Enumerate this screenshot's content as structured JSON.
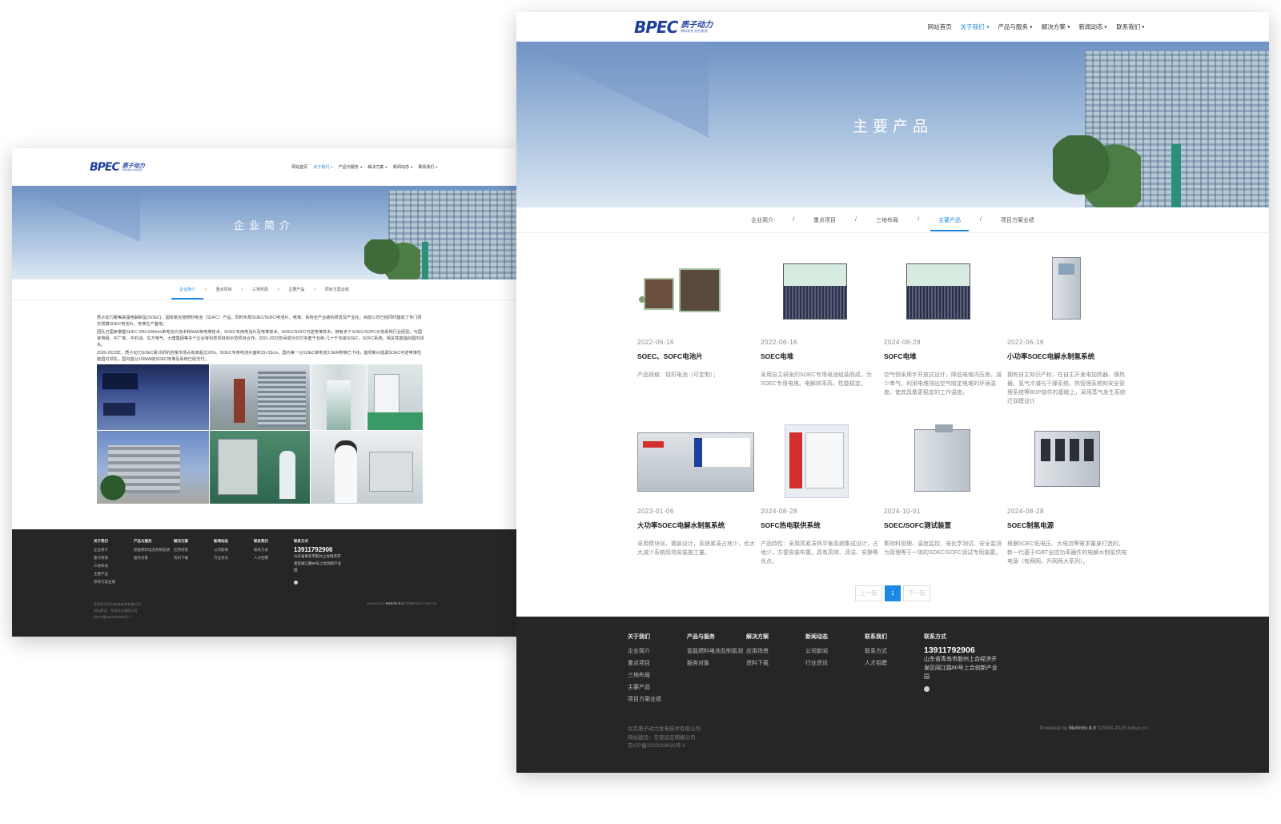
{
  "brand": {
    "logo_main": "BPEC",
    "logo_cn": "质子动力",
    "logo_sub": "燃料电池·综合能源"
  },
  "nav": [
    {
      "label": "网站首页",
      "dropdown": false,
      "active": false
    },
    {
      "label": "关于我们",
      "dropdown": true,
      "active": true
    },
    {
      "label": "产品与服务",
      "dropdown": true,
      "active": false
    },
    {
      "label": "解决方案",
      "dropdown": true,
      "active": false
    },
    {
      "label": "新闻动态",
      "dropdown": true,
      "active": false
    },
    {
      "label": "联系我们",
      "dropdown": true,
      "active": false
    }
  ],
  "tabs": [
    "企业简介",
    "重点项目",
    "三地布局",
    "主要产品",
    "项目方案业绩"
  ],
  "separator": "/",
  "left_page": {
    "banner_title": "企业简介",
    "active_tab": 0,
    "intro": [
      "质子动力聚焦高温电解制氢(SOEC)、固体氧化物燃料电池（SOFC）产品，同时布局SOEC/SOFC电池片、电堆、系统全产业链的研发及产业化。目前公司已经同时建成了专门研究规模SOEC电池片、电堆生产基地。",
      "团队已国家掌握SOFC 200×200mm单电池片技术和5kW单电堆技术，SOEC专用电池片及电堆技术。SOEC/SOFC可逆电堆技术。拥有多个SOEC/SOFC示范系统行业经验，与国家电网、中广核、中石油、东方电气、大唐集团等多个企业有科技项目和示范项目合作。2021-2023年间成功交付多套千瓦级-几十千瓦级SOEC、SOFC系统，相关性能指标国内领先。",
      "2020-2023年，质子动力SOEC累计研机容量市场占有率超过20%。SOEC专用电池片面积15×15cm，国内第一台SOEC单电池3.5kW电堆已下线，首项新兴能源SOEC可逆电堆性能国内领先，国内首台100kW级SOEC电堆及系统已经交付。"
    ]
  },
  "right_page": {
    "banner_title": "主要产品",
    "active_tab": 3,
    "products": [
      {
        "date": "2022-06-16",
        "name": "SOEC、SOFC电池片",
        "desc": "产品规格：钮扣电池（可定制）；",
        "kind": "plates"
      },
      {
        "date": "2022-06-16",
        "name": "SOEC电堆",
        "desc": "采用自主研发的SOEC专用电池组装而成，为SOEC专用电堆。电解效率高，性能稳定。",
        "kind": "stack"
      },
      {
        "date": "2024-08-28",
        "name": "SOFC电堆",
        "desc": "空气侧采用半开放式设计，降低电堆内压差，减少串气，利用电堆排出空气吸定电堆的环境温度，使其具备更稳定的工作温度。",
        "kind": "stack"
      },
      {
        "date": "2022-06-16",
        "name": "小功率SOEC电解水制氢系统",
        "desc": "拥有自主知识产权，在自主开发电加热器、换热器、氢气冷凝与干燥系统、热管理系统和安全管理系统等BOP部件的基础上，采用蒸气发生系统迁双模设计",
        "kind": "cabinet"
      },
      {
        "date": "2023-01-06",
        "name": "大功率SOEC电解水制氢系统",
        "desc": "采用模块化、撬装设计，系统紧凑占地少，也大大减少系统现场安装施工量。",
        "kind": "container"
      },
      {
        "date": "2024-08-28",
        "name": "SOFC热电联供系统",
        "desc": "产品特性：采用高紧凑热平衡系统集成设计，占地少，方便安装布置。具有高效、清洁、安静等优点。",
        "kind": "chp"
      },
      {
        "date": "2024-10-01",
        "name": "SOEC/SOFC测试装置",
        "desc": "集物料管理、温度监控、电化学测试、安全监测为管理等于一体的SOEC/SOFC测试专用装置。",
        "kind": "tester"
      },
      {
        "date": "2024-08-28",
        "name": "SOEC制氢电源",
        "desc": "根据SOEC低电压、大电流等需求量身打造的，新一代基于IGBT全控功率器件的电解水制氢供电电源（有两网、升网两大系列）。",
        "kind": "power"
      }
    ],
    "pagination": {
      "prev": "上一页",
      "current": "1",
      "next": "下一页"
    }
  },
  "footer": {
    "columns": [
      {
        "title": "关于我们",
        "items": [
          "企业简介",
          "重点项目",
          "三地布局",
          "主要产品",
          "项目方案业绩"
        ]
      },
      {
        "title": "产品与服务",
        "items": [
          "氢能燃料电池及制氢测",
          "服务对象"
        ]
      },
      {
        "title": "解决方案",
        "items": [
          "应用场景",
          "资料下载"
        ]
      },
      {
        "title": "新闻动态",
        "items": [
          "公司新闻",
          "行业资讯"
        ]
      },
      {
        "title": "联系我们",
        "items": [
          "联系方式",
          "人才招聘"
        ]
      }
    ],
    "contact_title": "联系方式",
    "phone": "13911792906",
    "address": "山东省青岛市胶州上合经济开发区阔江路60号上合创新产业园",
    "company": "北京质子动力发电技术有限公司",
    "builder": "网站建设：东营远见网络公司",
    "icp": "京ICP备2022019020号-1",
    "powered_prefix": "Powered by",
    "powered_name": "MetInfo 8.0",
    "powered_suffix": "©2008-2025  mituo.cn",
    "powered_suffix_left": "©2008-2023  mituo.cn"
  }
}
